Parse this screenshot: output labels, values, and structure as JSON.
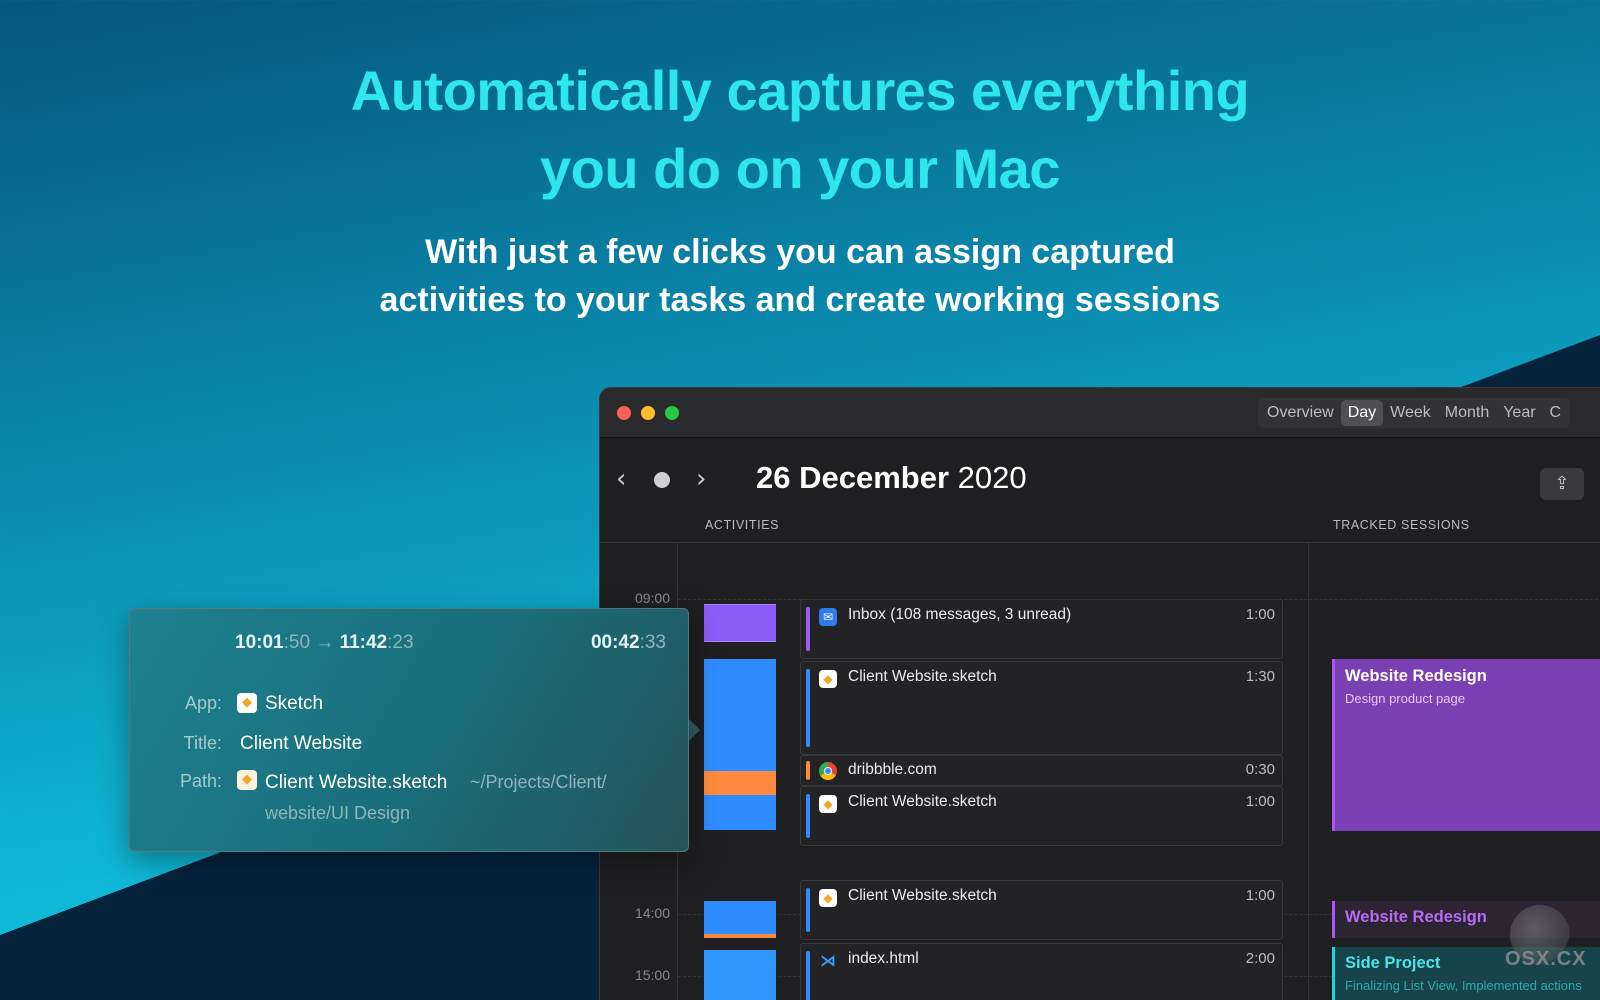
{
  "hero": {
    "headline_line1": "Automatically captures everything",
    "headline_line2": "you do on your Mac",
    "subhead_line1": "With just a few clicks you can assign captured",
    "subhead_line2": "activities to your tasks and create working sessions"
  },
  "window": {
    "view_tabs": [
      "Overview",
      "Day",
      "Week",
      "Month",
      "Year",
      "C"
    ],
    "active_tab": "Day",
    "date_day": "26 December",
    "date_year": "2020",
    "columns": {
      "activities": "ACTIVITIES",
      "sessions": "TRACKED SESSIONS"
    },
    "hours": [
      "09:00",
      "14:00",
      "15:00"
    ],
    "activities": [
      {
        "name": "Inbox (108 messages, 3 unread)",
        "duration": "1:00",
        "icon": "mail-icon",
        "color": "#9b5cf6"
      },
      {
        "name": "Client Website.sketch",
        "duration": "1:30",
        "icon": "sketch-icon",
        "color": "#2f8cff"
      },
      {
        "name": "dribbble.com",
        "duration": "0:30",
        "icon": "chrome-icon",
        "color": "#ff8a2f"
      },
      {
        "name": "Client Website.sketch",
        "duration": "1:00",
        "icon": "sketch-icon",
        "color": "#2f8cff"
      },
      {
        "name": "Client Website.sketch",
        "duration": "1:00",
        "icon": "sketch-icon",
        "color": "#2f8cff"
      },
      {
        "name": "index.html",
        "duration": "2:00",
        "icon": "vscode-icon",
        "color": "#2f8cff"
      }
    ],
    "sessions": [
      {
        "title": "Website Redesign",
        "subtitle": "Design product page",
        "color": "#a855f7"
      },
      {
        "title": "Website Redesign",
        "color": "#a855f7"
      },
      {
        "title": "Side Project",
        "subtitle": "Finalizing List View, Implemented actions",
        "color": "#22d3d8"
      }
    ]
  },
  "popover": {
    "start_main": "10:01",
    "start_sec": ":50",
    "arrow": "→",
    "end_main": "11:42",
    "end_sec": ":23",
    "duration_main": "00:42",
    "duration_sec": ":33",
    "app_label": "App:",
    "app_value": "Sketch",
    "title_label": "Title:",
    "title_value": "Client Website",
    "path_label": "Path:",
    "path_file": "Client Website.sketch",
    "path_dir_line1": "~/Projects/Client/",
    "path_dir_line2": "website/UI Design"
  },
  "watermark": {
    "text": "OSX.CX"
  }
}
